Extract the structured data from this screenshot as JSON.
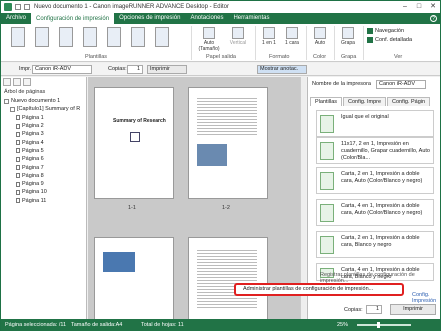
{
  "window": {
    "title": "Nuevo documento 1 - Canon imageRUNNER ADVANCE Desktop - Editor"
  },
  "tabs": [
    {
      "label": "Archivo"
    },
    {
      "label": "Configuración de impresión"
    },
    {
      "label": "Opciones de impresión"
    },
    {
      "label": "Anotaciones"
    },
    {
      "label": "Herramientas"
    }
  ],
  "ribbon": {
    "plantillas_label": "Plantillas",
    "papel_salida_label": "Papel salida",
    "formato_label": "Formato",
    "color_label": "Color",
    "grapa_label": "Grapa",
    "ver_label": "Ver",
    "auto_label": "Auto (Tamaño)",
    "vertical_label": "Vertical",
    "en1_label": "1 en 1",
    "cara_label": "1 cara",
    "auto2_label": "Auto",
    "grapa_btn_label": "Grapa",
    "navegacion_label": "Navegación",
    "conf_detallada_label": "Conf. detallada"
  },
  "toolbar": {
    "impr_label": "Impr.",
    "printer_value": "Canon iR-ADV",
    "copias_label": "Copias:",
    "copias_value": "1",
    "imprimir_label": "Imprimir",
    "mostrar_label": "Mostrar anotac."
  },
  "left_pane": {
    "title": "Árbol de páginas",
    "items": [
      {
        "label": "Nuevo documento 1",
        "level": 0
      },
      {
        "label": "[Capítulo1] Summary of R",
        "level": 1
      },
      {
        "label": "Página 1",
        "level": 2
      },
      {
        "label": "Página 2",
        "level": 2
      },
      {
        "label": "Página 3",
        "level": 2
      },
      {
        "label": "Página 4",
        "level": 2
      },
      {
        "label": "Página 5",
        "level": 2
      },
      {
        "label": "Página 6",
        "level": 2
      },
      {
        "label": "Página 7",
        "level": 2
      },
      {
        "label": "Página 8",
        "level": 2
      },
      {
        "label": "Página 9",
        "level": 2
      },
      {
        "label": "Página 10",
        "level": 2
      },
      {
        "label": "Página 11",
        "level": 2
      }
    ]
  },
  "center": {
    "pages": [
      {
        "label": "1-1",
        "title": "Summary of Research"
      },
      {
        "label": "1-2"
      },
      {
        "label": ""
      },
      {
        "label": ""
      }
    ]
  },
  "right_pane": {
    "printer_label": "Nombre de la impresora",
    "printer_value": "Canon iR-ADV",
    "tabs": [
      {
        "label": "Plantillas"
      },
      {
        "label": "Config. Impre"
      },
      {
        "label": "Config. Págin"
      }
    ],
    "favorites": [
      {
        "label": "Igual que el original"
      },
      {
        "label": "11x17, 2 en 1, Impresión en cuadernillo, Grapar cuadernillo, Auto (Color/Bla..."
      },
      {
        "label": "Carta, 2 en 1, Impresión a doble cara, Auto (Color/Blanco y negro)"
      },
      {
        "label": "Carta, 4 en 1, Impresión a doble cara, Auto (Color/Blanco y negro)"
      },
      {
        "label": "Carta, 2 en 1, Impresión a doble cara, Blanco y negro"
      },
      {
        "label": "Carta, 4 en 1, Impresión a doble cara, Blanco y negro"
      }
    ],
    "registrar_label": "Registrar plantillas de configuración de impresión...",
    "config_label": "Config. Impresión"
  },
  "popup": {
    "label": "Administrar plantillas de configuración de impresión..."
  },
  "bottom_right": {
    "copias_label": "Copias:",
    "copias_value": "1",
    "imprimir_label": "Imprimir"
  },
  "status": {
    "paginas": "Página seleccionada: /11",
    "tamano": "Tamaño de salida:A4",
    "total": "Total de hojas: 11",
    "zoom": "25%"
  },
  "colors": {
    "brand": "#217346",
    "highlight": "#e02020"
  }
}
